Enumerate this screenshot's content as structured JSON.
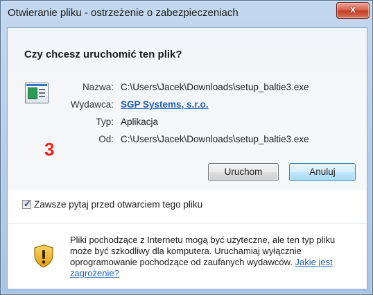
{
  "window": {
    "title": "Otwieranie pliku - ostrzeżenie o zabezpieczeniach",
    "close_label": "x"
  },
  "dialog": {
    "question": "Czy chcesz uruchomić ten plik?",
    "fields": [
      {
        "label": "Nazwa:",
        "value": "C:\\Users\\Jacek\\Downloads\\setup_baltie3.exe"
      },
      {
        "label": "Wydawca:",
        "value": "SGP Systems, s.r.o."
      },
      {
        "label": "Typ:",
        "value": "Aplikacja"
      },
      {
        "label": "Od:",
        "value": "C:\\Users\\Jacek\\Downloads\\setup_baltie3.exe"
      }
    ],
    "annotation_number": "3",
    "buttons": {
      "run_label": "Uruchom",
      "cancel_label": "Anuluj"
    },
    "checkbox": {
      "label": "Zawsze pytaj przed otwarciem tego pliku",
      "checked": true
    },
    "warning": {
      "text": "Pliki pochodzące z Internetu mogą być użyteczne, ale ten typ pliku może być szkodliwy dla komputera. Uruchamiaj wyłącznie oprogramowanie pochodzące od zaufanych wydawców.",
      "link": "Jakie jest zagrożenie?"
    }
  },
  "icons": {
    "file": "application-file-icon",
    "warning": "security-shield-warning-icon",
    "close": "close-icon"
  },
  "colors": {
    "link": "#1f5fb6",
    "annotation": "#e8261a",
    "title_bar": "#b8d0ea"
  }
}
